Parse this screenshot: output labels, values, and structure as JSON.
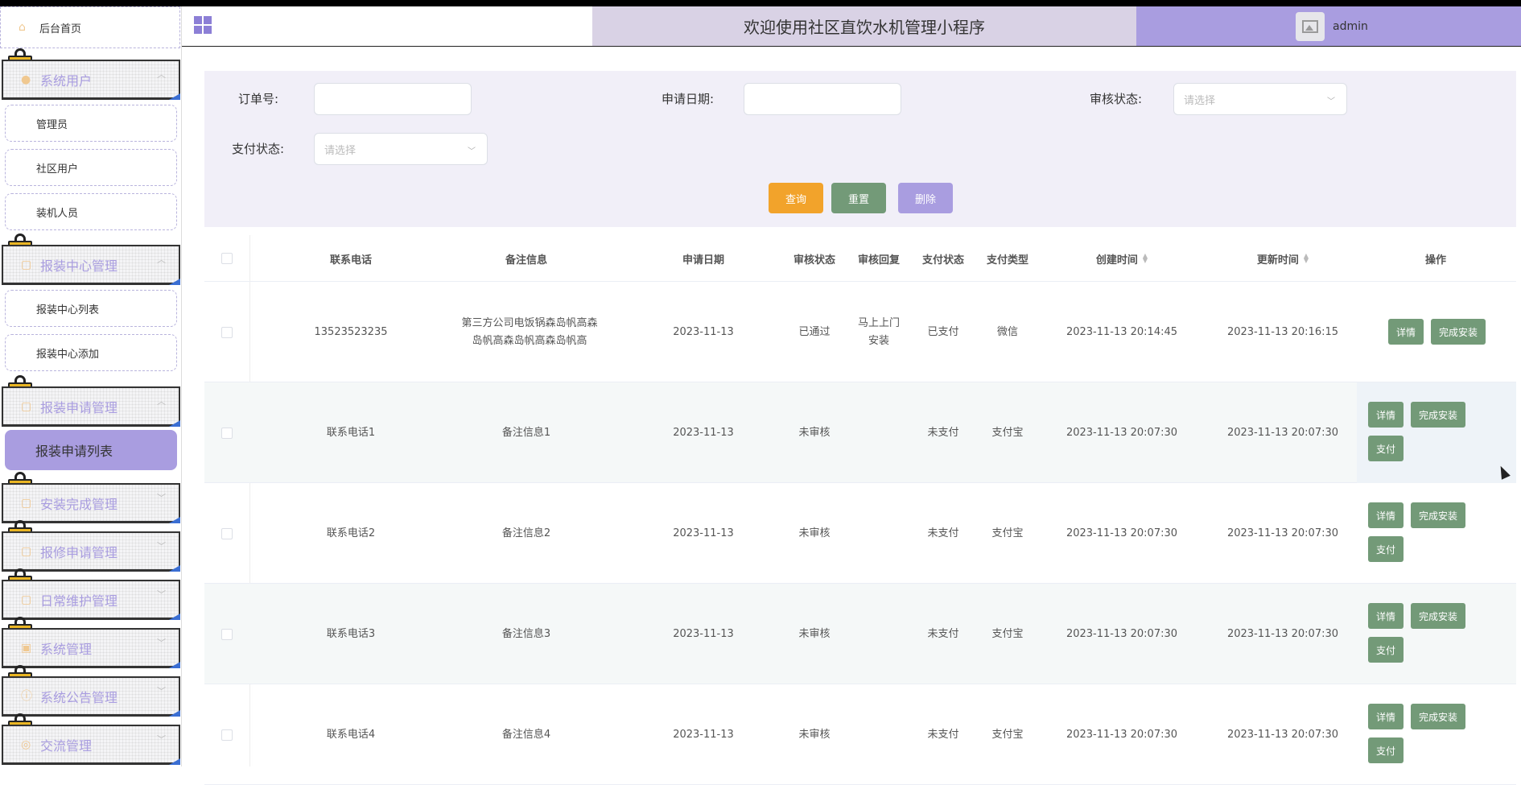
{
  "sidebar": {
    "home_label": "后台首页",
    "groups": [
      {
        "label": "系统用户"
      },
      {
        "label": "报装中心管理"
      },
      {
        "label": "报装申请管理"
      },
      {
        "label": "安装完成管理"
      },
      {
        "label": "报修申请管理"
      },
      {
        "label": "日常维护管理"
      },
      {
        "label": "系统管理"
      },
      {
        "label": "系统公告管理"
      },
      {
        "label": "交流管理"
      }
    ],
    "subs": [
      {
        "label": "管理员"
      },
      {
        "label": "社区用户"
      },
      {
        "label": "装机人员"
      },
      {
        "label": "报装中心列表"
      },
      {
        "label": "报装中心添加"
      },
      {
        "label": "报装申请列表"
      }
    ]
  },
  "header": {
    "title": "欢迎使用社区直饮水机管理小程序",
    "username": "admin"
  },
  "search": {
    "order_label": "订单号:",
    "apply_date_label": "申请日期:",
    "audit_status_label": "审核状态:",
    "pay_status_label": "支付状态:",
    "select_placeholder": "请选择",
    "query_button": "查询",
    "reset_button": "重置",
    "delete_button": "删除"
  },
  "table": {
    "columns": [
      "联系电话",
      "备注信息",
      "申请日期",
      "审核状态",
      "审核回复",
      "支付状态",
      "支付类型",
      "创建时间",
      "更新时间",
      "操作"
    ],
    "rows": [
      {
        "phone": "13523523235",
        "note": "第三方公司电饭锅森岛帆高森岛帆高森岛帆高森岛帆高",
        "apply_date": "2023-11-13",
        "audit_status": "已通过",
        "audit_reply": "马上上门安装",
        "pay_status": "已支付",
        "pay_type": "微信",
        "created": "2023-11-13 20:14:45",
        "updated": "2023-11-13 20:16:15"
      },
      {
        "phone": "联系电话1",
        "note": "备注信息1",
        "apply_date": "2023-11-13",
        "audit_status": "未审核",
        "audit_reply": "",
        "pay_status": "未支付",
        "pay_type": "支付宝",
        "created": "2023-11-13 20:07:30",
        "updated": "2023-11-13 20:07:30"
      },
      {
        "phone": "联系电话2",
        "note": "备注信息2",
        "apply_date": "2023-11-13",
        "audit_status": "未审核",
        "audit_reply": "",
        "pay_status": "未支付",
        "pay_type": "支付宝",
        "created": "2023-11-13 20:07:30",
        "updated": "2023-11-13 20:07:30"
      },
      {
        "phone": "联系电话3",
        "note": "备注信息3",
        "apply_date": "2023-11-13",
        "audit_status": "未审核",
        "audit_reply": "",
        "pay_status": "未支付",
        "pay_type": "支付宝",
        "created": "2023-11-13 20:07:30",
        "updated": "2023-11-13 20:07:30"
      },
      {
        "phone": "联系电话4",
        "note": "备注信息4",
        "apply_date": "2023-11-13",
        "audit_status": "未审核",
        "audit_reply": "",
        "pay_status": "未支付",
        "pay_type": "支付宝",
        "created": "2023-11-13 20:07:30",
        "updated": "2023-11-13 20:07:30"
      }
    ],
    "actions": {
      "detail": "详情",
      "complete": "完成安装",
      "pay": "支付"
    }
  },
  "colors": {
    "accent": "#a99de0",
    "query_btn": "#f2a32b",
    "reset_btn": "#739a78",
    "delete_btn": "#a99de0",
    "op_btn": "#739a78"
  },
  "icons": [
    "home-icon",
    "user-icon",
    "document-icon",
    "grid-menu-icon",
    "avatar-image-icon",
    "chevron-down-icon",
    "sort-icon"
  ]
}
